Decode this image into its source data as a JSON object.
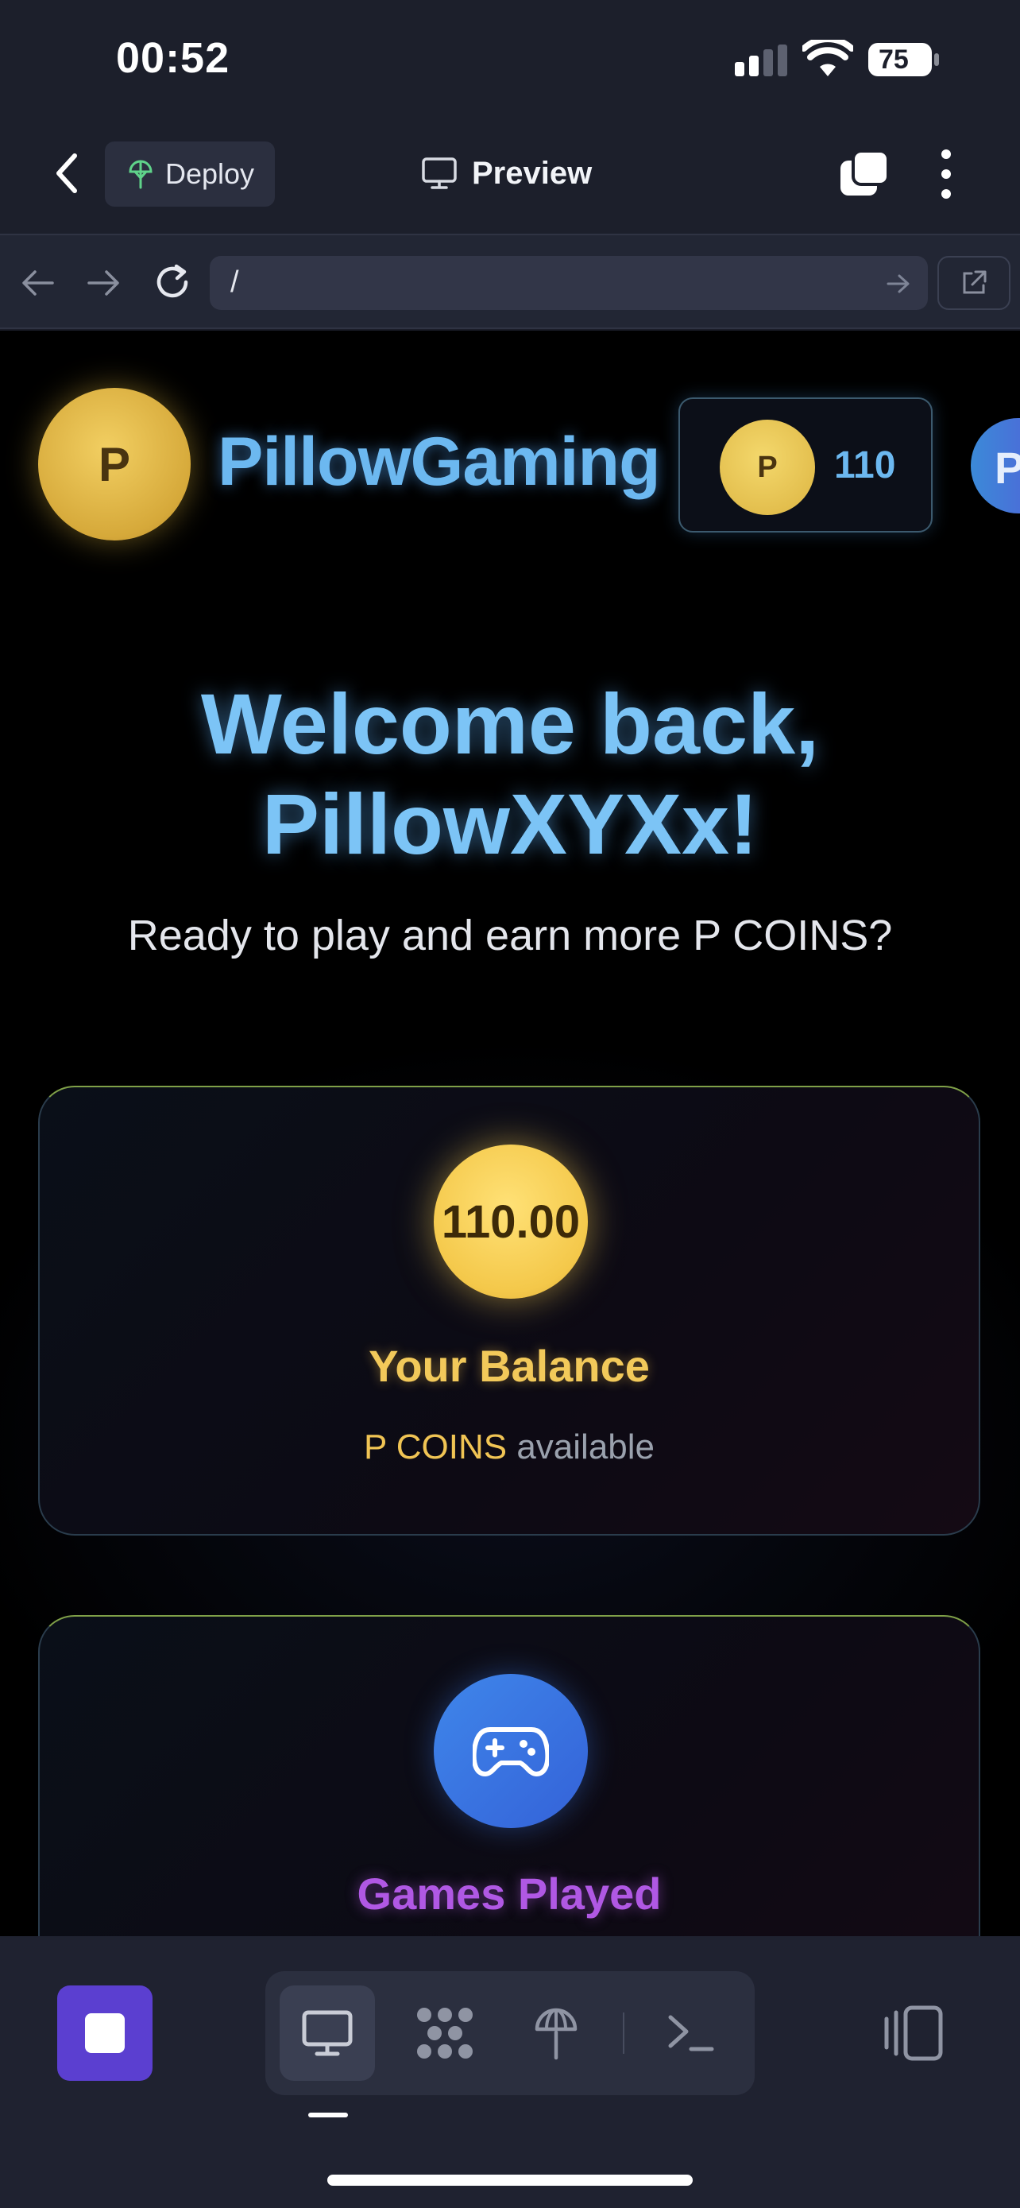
{
  "status_bar": {
    "time": "00:52",
    "battery": "75"
  },
  "topbar": {
    "deploy_label": "Deploy",
    "preview_title": "Preview"
  },
  "browser": {
    "url": "/"
  },
  "site": {
    "logo_letter": "P",
    "brand_name": "PillowGaming",
    "coin_letter": "P",
    "coin_balance_short": "110",
    "avatar_letter": "P",
    "welcome_line1": "Welcome back,",
    "welcome_line2": "PillowXYXx!",
    "tagline": "Ready to play and earn more P COINS?",
    "balance_card": {
      "amount": "110.00",
      "title": "Your Balance",
      "currency": "P COINS",
      "suffix": " available"
    },
    "games_card": {
      "title": "Games Played"
    }
  },
  "colors": {
    "accent_blue": "#6cb8f0",
    "coin_gold": "#f4c84a",
    "games_purple": "#b058e4",
    "stop_button": "#5b3fd0"
  },
  "icons": {
    "back": "chevron-left-icon",
    "deploy": "deploy-icon",
    "preview": "monitor-icon",
    "tabs": "tabs-icon",
    "more": "more-vertical-icon",
    "games": "gamepad-icon"
  }
}
